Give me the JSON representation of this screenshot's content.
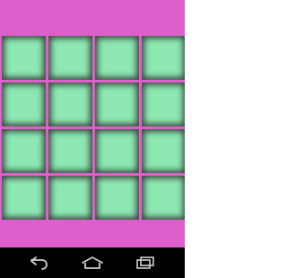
{
  "colors": {
    "background": "#dd5fcc",
    "grid_line": "#dd5fcc",
    "tile_face": "#8de8b2",
    "tile_edge": "#3a4a40",
    "navbar": "#000000",
    "nav_icon": "#cfcfcf"
  },
  "board": {
    "rows": 4,
    "cols": 4
  },
  "navbar": {
    "back_icon": "back-arrow-icon",
    "home_icon": "home-icon",
    "recents_icon": "recent-apps-icon"
  }
}
